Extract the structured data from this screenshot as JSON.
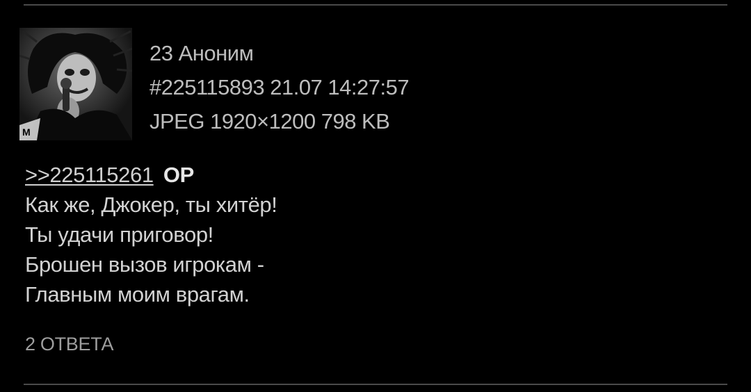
{
  "post": {
    "number": "23",
    "author": "Аноним",
    "post_id_line": "#225115893 21.07 14:27:57",
    "file_info": "JPEG 1920×1200 798 KB",
    "thumbnail_icon": "post-thumbnail-image",
    "reply_to": ">>225115261",
    "op_label": "OP",
    "message_lines": [
      "Как же, Джокер, ты хитёр!",
      "Ты удачи приговор!",
      "Брошен вызов игрокам -",
      "Главным моим врагам."
    ],
    "replies_label": "2 ОТВЕТА"
  },
  "colors": {
    "background": "#000000",
    "text": "#d2d2d2",
    "meta": "#bdbdbd",
    "divider": "#4a4a4a"
  }
}
